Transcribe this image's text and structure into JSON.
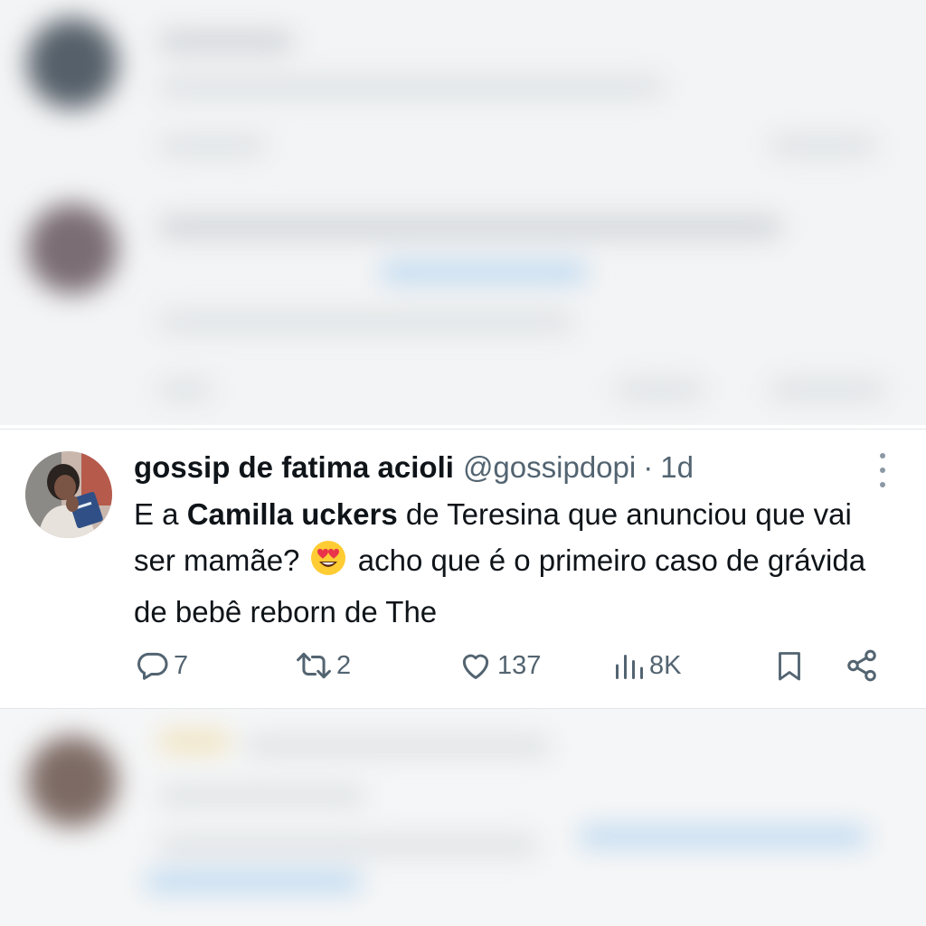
{
  "post": {
    "display_name": "gossip de fatima acioli",
    "handle": "@gossipdopi",
    "separator": "·",
    "time": "1d",
    "text": {
      "part1": "E a ",
      "bold": "Camilla uckers",
      "part2": " de Teresina que anunciou que vai ser mamãe?",
      "emoji_icon": "heart-eyes-emoji",
      "part3": " acho que é o primeiro caso de grávida de bebê reborn de The"
    },
    "stats": {
      "replies": "7",
      "reposts": "2",
      "likes": "137",
      "views": "8K"
    },
    "icons": [
      "reply-icon",
      "repost-icon",
      "like-icon",
      "views-icon",
      "bookmark-icon",
      "share-icon",
      "more-icon"
    ]
  },
  "colors": {
    "text": "#0f1419",
    "secondary": "#536471",
    "divider": "#e3e6e8"
  }
}
